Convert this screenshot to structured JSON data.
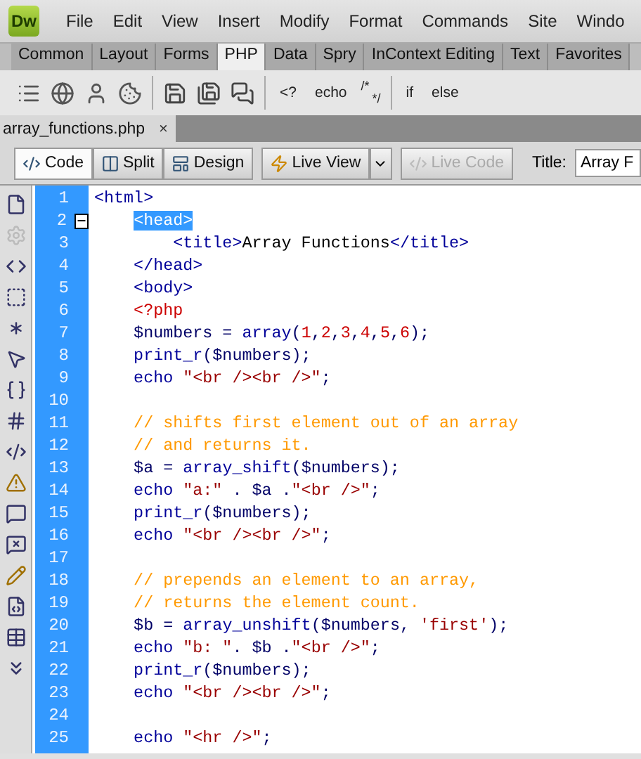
{
  "app": {
    "logo": "Dw"
  },
  "menu": [
    "File",
    "Edit",
    "View",
    "Insert",
    "Modify",
    "Format",
    "Commands",
    "Site",
    "Windo"
  ],
  "insert_tabs": [
    {
      "label": "Common",
      "selected": false
    },
    {
      "label": "Layout",
      "selected": false
    },
    {
      "label": "Forms",
      "selected": false
    },
    {
      "label": "PHP",
      "selected": true
    },
    {
      "label": "Data",
      "selected": false
    },
    {
      "label": "Spry",
      "selected": false
    },
    {
      "label": "InContext Editing",
      "selected": false
    },
    {
      "label": "Text",
      "selected": false
    },
    {
      "label": "Favorites",
      "selected": false
    }
  ],
  "insert_toolbar": {
    "text_buttons": [
      "<?",
      "echo"
    ],
    "comment_button": {
      "open": "/*",
      "close": "*/"
    },
    "text_buttons_2": [
      "if",
      "else"
    ]
  },
  "document_tab": {
    "filename": "array_functions.php",
    "close": "×"
  },
  "view_buttons": [
    {
      "label": "Code",
      "selected": true
    },
    {
      "label": "Split",
      "selected": false
    },
    {
      "label": "Design",
      "selected": false
    }
  ],
  "live_view": {
    "label": "Live View"
  },
  "live_code": {
    "label": "Live Code",
    "disabled": true
  },
  "title_field": {
    "label": "Title:",
    "value": "Array F"
  },
  "code_lines": [
    {
      "number": "1",
      "fold": false,
      "tokens": [
        {
          "kind": "tag",
          "s": "<html>"
        }
      ]
    },
    {
      "number": "2",
      "fold": true,
      "tokens": [
        {
          "kind": "selected",
          "s": "    <head>"
        }
      ]
    },
    {
      "number": "3",
      "fold": false,
      "tokens": [
        {
          "kind": "tag",
          "s": "        <title>"
        },
        {
          "kind": "plain",
          "s": "Array Functions"
        },
        {
          "kind": "tag",
          "s": "</title>"
        }
      ]
    },
    {
      "number": "4",
      "fold": false,
      "tokens": [
        {
          "kind": "tag",
          "s": "    </head>"
        }
      ]
    },
    {
      "number": "5",
      "fold": false,
      "tokens": [
        {
          "kind": "tag",
          "s": "    <body>"
        }
      ]
    },
    {
      "number": "6",
      "fold": false,
      "tokens": [
        {
          "kind": "php",
          "s": "    <?php"
        }
      ]
    },
    {
      "number": "7",
      "fold": false,
      "tokens": [
        {
          "kind": "var",
          "s": "    $numbers"
        },
        {
          "kind": "punct",
          "s": " = "
        },
        {
          "kind": "func",
          "s": "array"
        },
        {
          "kind": "punct",
          "s": "("
        },
        {
          "kind": "num",
          "s": "1"
        },
        {
          "kind": "punct",
          "s": ","
        },
        {
          "kind": "num",
          "s": "2"
        },
        {
          "kind": "punct",
          "s": ","
        },
        {
          "kind": "num",
          "s": "3"
        },
        {
          "kind": "punct",
          "s": ","
        },
        {
          "kind": "num",
          "s": "4"
        },
        {
          "kind": "punct",
          "s": ","
        },
        {
          "kind": "num",
          "s": "5"
        },
        {
          "kind": "punct",
          "s": ","
        },
        {
          "kind": "num",
          "s": "6"
        },
        {
          "kind": "punct",
          "s": ");"
        }
      ]
    },
    {
      "number": "8",
      "fold": false,
      "tokens": [
        {
          "kind": "func",
          "s": "    print_r"
        },
        {
          "kind": "punct",
          "s": "("
        },
        {
          "kind": "var",
          "s": "$numbers"
        },
        {
          "kind": "punct",
          "s": ");"
        }
      ]
    },
    {
      "number": "9",
      "fold": false,
      "tokens": [
        {
          "kind": "func",
          "s": "    echo"
        },
        {
          "kind": "str",
          "s": " \"<br /><br />\""
        },
        {
          "kind": "punct",
          "s": ";"
        }
      ]
    },
    {
      "number": "10",
      "fold": false
    },
    {
      "number": "11",
      "fold": false,
      "tokens": [
        {
          "kind": "comment",
          "s": "    // shifts first element out of an array"
        }
      ]
    },
    {
      "number": "12",
      "fold": false,
      "tokens": [
        {
          "kind": "comment",
          "s": "    // and returns it."
        }
      ]
    },
    {
      "number": "13",
      "fold": false,
      "tokens": [
        {
          "kind": "var",
          "s": "    $a"
        },
        {
          "kind": "punct",
          "s": " = "
        },
        {
          "kind": "func",
          "s": "array_shift"
        },
        {
          "kind": "punct",
          "s": "("
        },
        {
          "kind": "var",
          "s": "$numbers"
        },
        {
          "kind": "punct",
          "s": ");"
        }
      ]
    },
    {
      "number": "14",
      "fold": false,
      "tokens": [
        {
          "kind": "func",
          "s": "    echo"
        },
        {
          "kind": "str",
          "s": " \"a:\""
        },
        {
          "kind": "punct",
          "s": " . "
        },
        {
          "kind": "var",
          "s": "$a"
        },
        {
          "kind": "punct",
          "s": " ."
        },
        {
          "kind": "str",
          "s": "\"<br />\""
        },
        {
          "kind": "punct",
          "s": ";"
        }
      ]
    },
    {
      "number": "15",
      "fold": false,
      "tokens": [
        {
          "kind": "func",
          "s": "    print_r"
        },
        {
          "kind": "punct",
          "s": "("
        },
        {
          "kind": "var",
          "s": "$numbers"
        },
        {
          "kind": "punct",
          "s": ");"
        }
      ]
    },
    {
      "number": "16",
      "fold": false,
      "tokens": [
        {
          "kind": "func",
          "s": "    echo"
        },
        {
          "kind": "str",
          "s": " \"<br /><br />\""
        },
        {
          "kind": "punct",
          "s": ";"
        }
      ]
    },
    {
      "number": "17",
      "fold": false
    },
    {
      "number": "18",
      "fold": false,
      "tokens": [
        {
          "kind": "comment",
          "s": "    // prepends an element to an array,"
        }
      ]
    },
    {
      "number": "19",
      "fold": false,
      "tokens": [
        {
          "kind": "comment",
          "s": "    // returns the element count."
        }
      ]
    },
    {
      "number": "20",
      "fold": false,
      "tokens": [
        {
          "kind": "var",
          "s": "    $b"
        },
        {
          "kind": "punct",
          "s": " = "
        },
        {
          "kind": "func",
          "s": "array_unshift"
        },
        {
          "kind": "punct",
          "s": "("
        },
        {
          "kind": "var",
          "s": "$numbers"
        },
        {
          "kind": "punct",
          "s": ", "
        },
        {
          "kind": "str",
          "s": "'first'"
        },
        {
          "kind": "punct",
          "s": ");"
        }
      ]
    },
    {
      "number": "21",
      "fold": false,
      "tokens": [
        {
          "kind": "func",
          "s": "    echo"
        },
        {
          "kind": "str",
          "s": " \"b: \""
        },
        {
          "kind": "punct",
          "s": ". "
        },
        {
          "kind": "var",
          "s": "$b"
        },
        {
          "kind": "punct",
          "s": " ."
        },
        {
          "kind": "str",
          "s": "\"<br />\""
        },
        {
          "kind": "punct",
          "s": ";"
        }
      ]
    },
    {
      "number": "22",
      "fold": false,
      "tokens": [
        {
          "kind": "func",
          "s": "    print_r"
        },
        {
          "kind": "punct",
          "s": "("
        },
        {
          "kind": "var",
          "s": "$numbers"
        },
        {
          "kind": "punct",
          "s": ");"
        }
      ]
    },
    {
      "number": "23",
      "fold": false,
      "tokens": [
        {
          "kind": "func",
          "s": "    echo"
        },
        {
          "kind": "str",
          "s": " \"<br /><br />\""
        },
        {
          "kind": "punct",
          "s": ";"
        }
      ]
    },
    {
      "number": "24",
      "fold": false
    },
    {
      "number": "25",
      "fold": false,
      "tokens": [
        {
          "kind": "func",
          "s": "    echo"
        },
        {
          "kind": "str",
          "s": " \"<hr />\""
        },
        {
          "kind": "punct",
          "s": ";"
        }
      ]
    }
  ]
}
